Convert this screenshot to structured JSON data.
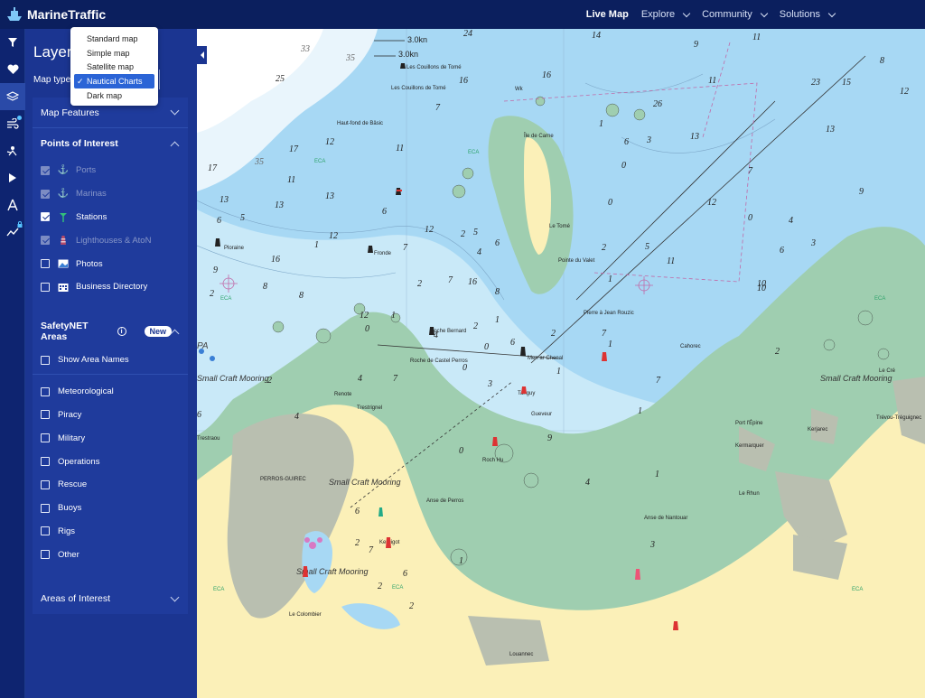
{
  "brand": {
    "name": "MarineTraffic"
  },
  "nav": {
    "live_map": "Live Map",
    "explore": "Explore",
    "community": "Community",
    "solutions": "Solutions"
  },
  "panel": {
    "title": "Layers",
    "map_type_label": "Map type",
    "map_type_options": [
      "Standard map",
      "Simple map",
      "Satellite map",
      "Nautical Charts",
      "Dark map"
    ],
    "map_type_selected": "Nautical Charts",
    "map_features": "Map Features",
    "poi": {
      "title": "Points of Interest",
      "items": [
        {
          "label": "Ports",
          "state": "disabled-checked",
          "icon": "anchor-icon"
        },
        {
          "label": "Marinas",
          "state": "disabled-checked",
          "icon": "anchor-icon"
        },
        {
          "label": "Stations",
          "state": "checked",
          "icon": "antenna-icon"
        },
        {
          "label": "Lighthouses & AtoN",
          "state": "disabled-checked",
          "icon": "lighthouse-icon"
        },
        {
          "label": "Photos",
          "state": "unchecked",
          "icon": "photo-icon"
        },
        {
          "label": "Business Directory",
          "state": "unchecked",
          "icon": "building-icon"
        }
      ]
    },
    "safetynet": {
      "title": "SafetyNET Areas",
      "badge": "New",
      "show_names": "Show Area Names",
      "items": [
        "Meteorological",
        "Piracy",
        "Military",
        "Operations",
        "Rescue",
        "Buoys",
        "Rigs",
        "Other"
      ]
    },
    "areas_of_interest": "Areas of Interest"
  },
  "map": {
    "labels": {
      "les_couillons_de_tome": "Les Couillons de Tomé",
      "les_couillons_de_tome_2": "Les Couillons de Tomé",
      "haut_fond_de_basic": "Haut-fond de Bâsic",
      "wk": "Wk",
      "ploraine": "Ploraine",
      "fronde": "Fronde",
      "pointe_du_valet": "Pointe du Valet",
      "roche_bernard": "Roche Bernard",
      "roche_de_castel_perros": "Roche de Castel Perros",
      "men_ar_chenal": "Men ar Chenal",
      "pierre_jean_rouzic": "Pierre à Jean Rouzic",
      "cahorec": "Cahorec",
      "le_cre": "Le Cré",
      "trestraou": "Trestraou",
      "trestrignel": "Trestrignel",
      "perros_guirec": "PERROS-GUIREC",
      "small_craft_mooring": "Small Craft Mooring",
      "anse_de_perros": "Anse de Perros",
      "anse_de_nantouar": "Anse de Nantouar",
      "roch_hu": "Roch Hu",
      "gueveur": "Gueveur",
      "port_epine": "Port l'Épine",
      "kerjarec": "Kerjarec",
      "trevou": "Trévou-Tréguignec",
      "kermarquer": "Kermarquer",
      "le_rhun": "Le Rhun",
      "louannec": "Louannec",
      "le_colombier": "Le Colombier",
      "renote": "Renote",
      "tanguy": "Tanguy",
      "kerbigot": "Kerbigot",
      "pa": "PA",
      "eca": "ECA",
      "speed_1": "3.0kn",
      "speed_2": "3.0kn",
      "isle_de_carne": "Île de Carne",
      "le_tome": "Le Tomé"
    },
    "depths": [
      "24",
      "14",
      "11",
      "9",
      "8",
      "23",
      "15",
      "12",
      "33",
      "35",
      "25",
      "16",
      "11",
      "7",
      "4",
      "3",
      "9",
      "16",
      "17",
      "12",
      "13",
      "11",
      "13",
      "5",
      "12",
      "6",
      "4",
      "2",
      "9",
      "3",
      "7",
      "6",
      "1",
      "35",
      "3"
    ]
  }
}
